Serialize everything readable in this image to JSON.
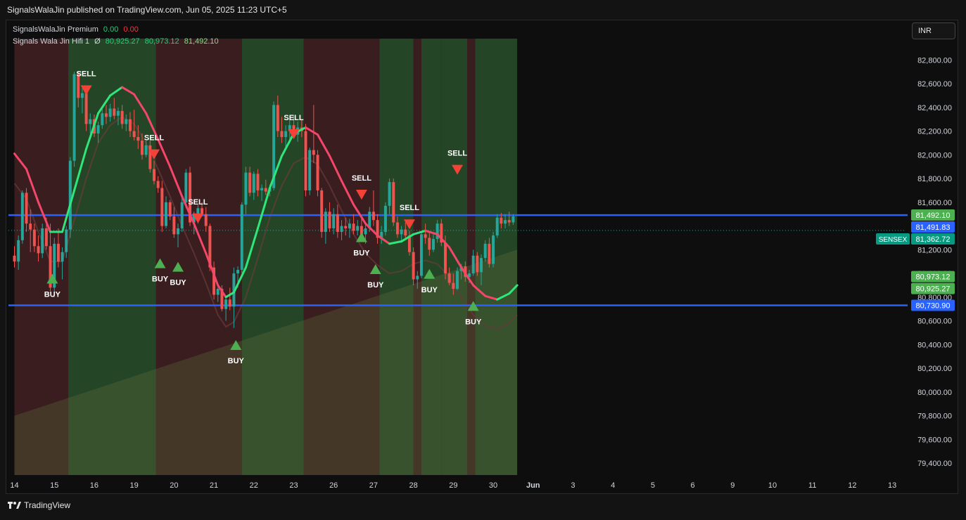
{
  "header": {
    "published": "SignalsWalaJin published on TradingView.com, Jun 05, 2025 11:23 UTC+5"
  },
  "legend": {
    "premium": {
      "name": "SignalsWalaJin Premium",
      "v1": "0.00",
      "v2": "0.00"
    },
    "hifi": {
      "name": "Signals Wala Jin Hifi 1",
      "symbol": "Ø",
      "v1": "80,925.27",
      "v2": "80,973.12",
      "v3": "81,492.10"
    }
  },
  "currency": "INR",
  "footer": {
    "brand": "TradingView"
  },
  "colors": {
    "up": "#26a69a",
    "down": "#ef5350",
    "curve_up": "#2ee67a",
    "curve_down": "#f4466a",
    "hline": "#2962ff",
    "zone_green": "#2d5a2f",
    "zone_red": "#4a2326"
  },
  "chart_data": {
    "type": "candlestick",
    "symbol": "SENSEX",
    "y_ticks": [
      79400,
      79600,
      79800,
      80000,
      80200,
      80400,
      80600,
      80800,
      81000,
      81200,
      81400,
      81600,
      81800,
      82000,
      82200,
      82400,
      82600,
      82800
    ],
    "y_tick_labels": [
      "79,400.00",
      "79,600.00",
      "79,800.00",
      "80,000.00",
      "80,200.00",
      "80,400.00",
      "80,600.00",
      "80,800.00",
      "81,000.00",
      "81,200.00",
      "81,400.00",
      "81,600.00",
      "81,800.00",
      "82,000.00",
      "82,200.00",
      "82,400.00",
      "82,600.00",
      "82,800.00"
    ],
    "ylim": [
      79300,
      82950
    ],
    "x_ticks": [
      {
        "label": "14",
        "t": 0
      },
      {
        "label": "15",
        "t": 1
      },
      {
        "label": "16",
        "t": 2
      },
      {
        "label": "19",
        "t": 3
      },
      {
        "label": "20",
        "t": 4
      },
      {
        "label": "21",
        "t": 5
      },
      {
        "label": "22",
        "t": 6
      },
      {
        "label": "23",
        "t": 7
      },
      {
        "label": "26",
        "t": 8
      },
      {
        "label": "27",
        "t": 9
      },
      {
        "label": "28",
        "t": 10
      },
      {
        "label": "29",
        "t": 11
      },
      {
        "label": "30",
        "t": 12
      },
      {
        "label": "Jun",
        "t": 13
      },
      {
        "label": "3",
        "t": 14
      },
      {
        "label": "4",
        "t": 15
      },
      {
        "label": "5",
        "t": 16
      },
      {
        "label": "6",
        "t": 17
      },
      {
        "label": "9",
        "t": 18
      },
      {
        "label": "10",
        "t": 19
      },
      {
        "label": "11",
        "t": 20
      },
      {
        "label": "12",
        "t": 21
      },
      {
        "label": "13",
        "t": 22
      }
    ],
    "xlim": [
      -0.15,
      22.35
    ],
    "candles": [
      [
        0.0,
        81150,
        81230,
        81050,
        81100
      ],
      [
        0.1,
        81100,
        81320,
        81030,
        81280
      ],
      [
        0.2,
        81280,
        81700,
        81250,
        81680
      ],
      [
        0.3,
        81680,
        81720,
        81350,
        81420
      ],
      [
        0.4,
        81420,
        81540,
        81180,
        81370
      ],
      [
        0.5,
        81370,
        81420,
        81180,
        81230
      ],
      [
        0.6,
        81230,
        81320,
        81100,
        81170
      ],
      [
        0.7,
        81170,
        81420,
        81130,
        81380
      ],
      [
        0.8,
        81380,
        81470,
        81200,
        81230
      ],
      [
        0.9,
        81230,
        81420,
        80850,
        80880
      ],
      [
        1.0,
        80880,
        81300,
        80800,
        81250
      ],
      [
        1.1,
        81250,
        81380,
        81050,
        81100
      ],
      [
        1.2,
        81100,
        81220,
        80950,
        81180
      ],
      [
        1.3,
        81180,
        81400,
        81130,
        81370
      ],
      [
        1.4,
        81370,
        81980,
        81300,
        81950
      ],
      [
        1.5,
        81950,
        82700,
        81900,
        82680
      ],
      [
        1.6,
        82680,
        82700,
        82400,
        82480
      ],
      [
        1.7,
        82480,
        82560,
        82350,
        82520
      ],
      [
        1.8,
        82520,
        82560,
        82200,
        82260
      ],
      [
        1.9,
        82260,
        82350,
        82180,
        82300
      ],
      [
        2.0,
        82300,
        82340,
        82150,
        82180
      ],
      [
        2.1,
        82180,
        82280,
        82100,
        82250
      ],
      [
        2.2,
        82250,
        82400,
        82220,
        82350
      ],
      [
        2.3,
        82350,
        82420,
        82260,
        82320
      ],
      [
        2.4,
        82320,
        82430,
        82280,
        82390
      ],
      [
        2.5,
        82390,
        82480,
        82300,
        82330
      ],
      [
        2.6,
        82330,
        82400,
        82250,
        82370
      ],
      [
        2.7,
        82370,
        82420,
        82220,
        82260
      ],
      [
        2.8,
        82260,
        82340,
        82200,
        82300
      ],
      [
        2.9,
        82300,
        82360,
        82150,
        82200
      ],
      [
        3.0,
        82200,
        82380,
        82120,
        82150
      ],
      [
        3.1,
        82150,
        82250,
        82050,
        82120
      ],
      [
        3.2,
        82120,
        82180,
        81960,
        82000
      ],
      [
        3.3,
        82000,
        82120,
        81980,
        82080
      ],
      [
        3.4,
        82080,
        82120,
        81850,
        81880
      ],
      [
        3.5,
        81880,
        81950,
        81750,
        81780
      ],
      [
        3.6,
        81780,
        81820,
        81680,
        81720
      ],
      [
        3.7,
        81720,
        81780,
        81350,
        81400
      ],
      [
        3.8,
        81400,
        81650,
        81380,
        81600
      ],
      [
        3.9,
        81600,
        81620,
        81450,
        81480
      ],
      [
        4.0,
        81480,
        81560,
        81300,
        81330
      ],
      [
        4.1,
        81330,
        81420,
        81220,
        81380
      ],
      [
        4.2,
        81380,
        81650,
        81350,
        81600
      ],
      [
        4.3,
        81600,
        81880,
        81550,
        81850
      ],
      [
        4.4,
        81850,
        81900,
        81400,
        81430
      ],
      [
        4.5,
        81430,
        81520,
        81330,
        81500
      ],
      [
        4.6,
        81500,
        81580,
        81420,
        81550
      ],
      [
        4.7,
        81550,
        81600,
        81480,
        81500
      ],
      [
        4.8,
        81500,
        81560,
        81350,
        81400
      ],
      [
        4.9,
        81400,
        81420,
        81020,
        81050
      ],
      [
        5.0,
        81050,
        81100,
        80780,
        80820
      ],
      [
        5.1,
        80820,
        80900,
        80760,
        80870
      ],
      [
        5.2,
        80870,
        80900,
        80680,
        80700
      ],
      [
        5.3,
        80700,
        80800,
        80600,
        80780
      ],
      [
        5.4,
        80780,
        80880,
        80690,
        80720
      ],
      [
        5.5,
        80720,
        81050,
        80540,
        81000
      ],
      [
        5.6,
        81000,
        81060,
        80880,
        81030
      ],
      [
        5.7,
        81030,
        81600,
        81000,
        81580
      ],
      [
        5.8,
        81580,
        81900,
        81500,
        81850
      ],
      [
        5.9,
        81850,
        81900,
        81650,
        81680
      ],
      [
        6.0,
        81680,
        81860,
        81620,
        81840
      ],
      [
        6.1,
        81840,
        81880,
        81650,
        81700
      ],
      [
        6.2,
        81700,
        81750,
        81610,
        81720
      ],
      [
        6.3,
        81720,
        81790,
        81660,
        81690
      ],
      [
        6.4,
        81690,
        81750,
        81650,
        81720
      ],
      [
        6.5,
        81720,
        82450,
        81700,
        82420
      ],
      [
        6.6,
        82420,
        82500,
        82150,
        82200
      ],
      [
        6.7,
        82200,
        82320,
        82100,
        82150
      ],
      [
        6.8,
        82150,
        82250,
        82060,
        82200
      ],
      [
        6.9,
        82200,
        82300,
        82120,
        82250
      ],
      [
        7.0,
        82250,
        82330,
        82140,
        82170
      ],
      [
        7.1,
        82170,
        82280,
        82110,
        82230
      ],
      [
        7.2,
        82230,
        82300,
        82150,
        82200
      ],
      [
        7.3,
        82200,
        82260,
        81650,
        81700
      ],
      [
        7.4,
        81700,
        82060,
        81660,
        82040
      ],
      [
        7.5,
        82040,
        82420,
        81930,
        82000
      ],
      [
        7.6,
        82000,
        82040,
        81650,
        81700
      ],
      [
        7.7,
        81700,
        81720,
        81300,
        81350
      ],
      [
        7.8,
        81350,
        81550,
        81250,
        81520
      ],
      [
        7.9,
        81520,
        81600,
        81350,
        81380
      ],
      [
        8.0,
        81380,
        81550,
        81330,
        81500
      ],
      [
        8.1,
        81500,
        81580,
        81300,
        81350
      ],
      [
        8.2,
        81350,
        81450,
        81280,
        81400
      ],
      [
        8.3,
        81400,
        81470,
        81320,
        81380
      ],
      [
        8.4,
        81380,
        81460,
        81300,
        81420
      ],
      [
        8.5,
        81420,
        81500,
        81330,
        81360
      ],
      [
        8.6,
        81360,
        81450,
        81320,
        81400
      ],
      [
        8.7,
        81400,
        81480,
        81300,
        81330
      ],
      [
        8.8,
        81330,
        81420,
        81250,
        81380
      ],
      [
        8.9,
        81380,
        81560,
        81350,
        81520
      ],
      [
        9.0,
        81520,
        81700,
        81400,
        81450
      ],
      [
        9.1,
        81450,
        81500,
        81250,
        81300
      ],
      [
        9.2,
        81300,
        81400,
        81250,
        81350
      ],
      [
        9.3,
        81350,
        81600,
        81320,
        81570
      ],
      [
        9.4,
        81570,
        81800,
        81500,
        81770
      ],
      [
        9.5,
        81770,
        81800,
        81400,
        81430
      ],
      [
        9.6,
        81430,
        81480,
        81300,
        81330
      ],
      [
        9.7,
        81330,
        81400,
        81280,
        81370
      ],
      [
        9.8,
        81370,
        81430,
        81300,
        81320
      ],
      [
        9.9,
        81320,
        81360,
        81150,
        81180
      ],
      [
        10.0,
        81180,
        81220,
        80900,
        80950
      ],
      [
        10.1,
        80950,
        81020,
        80870,
        80980
      ],
      [
        10.2,
        80980,
        81350,
        80960,
        81330
      ],
      [
        10.3,
        81330,
        81420,
        81250,
        81300
      ],
      [
        10.4,
        81300,
        81350,
        81150,
        81200
      ],
      [
        10.5,
        81200,
        81330,
        81180,
        81290
      ],
      [
        10.6,
        81290,
        81450,
        81260,
        81420
      ],
      [
        10.7,
        81420,
        81460,
        81230,
        81260
      ],
      [
        10.8,
        81260,
        81320,
        80950,
        81000
      ],
      [
        10.9,
        81000,
        81050,
        80900,
        80920
      ],
      [
        11.0,
        80920,
        81000,
        80820,
        80870
      ],
      [
        11.1,
        80870,
        81050,
        80860,
        81020
      ],
      [
        11.2,
        81020,
        81080,
        80950,
        81060
      ],
      [
        11.3,
        81060,
        81100,
        80930,
        80970
      ],
      [
        11.4,
        80970,
        81030,
        80920,
        81000
      ],
      [
        11.5,
        81000,
        81200,
        80980,
        81150
      ],
      [
        11.6,
        81150,
        81180,
        80980,
        81010
      ],
      [
        11.7,
        81010,
        81160,
        80900,
        81130
      ],
      [
        11.8,
        81130,
        81280,
        81100,
        81250
      ],
      [
        11.9,
        81250,
        81300,
        81050,
        81080
      ],
      [
        12.0,
        81080,
        81350,
        81050,
        81320
      ],
      [
        12.1,
        81320,
        81500,
        81300,
        81470
      ],
      [
        12.2,
        81470,
        81510,
        81380,
        81420
      ],
      [
        12.3,
        81420,
        81500,
        81380,
        81450
      ],
      [
        12.4,
        81450,
        81520,
        81400,
        81430
      ],
      [
        12.5,
        81430,
        81500,
        81410,
        81480
      ]
    ],
    "curve": [
      [
        0,
        82010
      ],
      [
        0.3,
        81880
      ],
      [
        0.6,
        81600
      ],
      [
        0.9,
        81350
      ],
      [
        1.2,
        81350
      ],
      [
        1.5,
        81700
      ],
      [
        1.8,
        82050
      ],
      [
        2.1,
        82350
      ],
      [
        2.4,
        82500
      ],
      [
        2.7,
        82570
      ],
      [
        3.0,
        82510
      ],
      [
        3.3,
        82350
      ],
      [
        3.6,
        82130
      ],
      [
        3.9,
        81900
      ],
      [
        4.2,
        81650
      ],
      [
        4.5,
        81420
      ],
      [
        4.8,
        81170
      ],
      [
        5.1,
        80900
      ],
      [
        5.3,
        80800
      ],
      [
        5.5,
        80840
      ],
      [
        5.8,
        81050
      ],
      [
        6.1,
        81380
      ],
      [
        6.4,
        81720
      ],
      [
        6.7,
        81990
      ],
      [
        7.0,
        82180
      ],
      [
        7.3,
        82230
      ],
      [
        7.6,
        82170
      ],
      [
        7.9,
        81990
      ],
      [
        8.2,
        81780
      ],
      [
        8.5,
        81580
      ],
      [
        8.8,
        81420
      ],
      [
        9.1,
        81320
      ],
      [
        9.4,
        81250
      ],
      [
        9.7,
        81270
      ],
      [
        10.0,
        81330
      ],
      [
        10.3,
        81360
      ],
      [
        10.6,
        81330
      ],
      [
        10.9,
        81220
      ],
      [
        11.2,
        81050
      ],
      [
        11.5,
        80900
      ],
      [
        11.8,
        80810
      ],
      [
        12.1,
        80780
      ],
      [
        12.4,
        80830
      ],
      [
        12.6,
        80900
      ]
    ],
    "hlines": [
      81491.83,
      80730.9
    ],
    "signals": [
      {
        "type": "BUY",
        "x": 0.95,
        "y": 80950
      },
      {
        "type": "SELL",
        "x": 1.8,
        "y": 82550
      },
      {
        "type": "SELL",
        "x": 3.5,
        "y": 82010
      },
      {
        "type": "BUY",
        "x": 3.65,
        "y": 81080
      },
      {
        "type": "BUY",
        "x": 4.1,
        "y": 81050
      },
      {
        "type": "SELL",
        "x": 4.6,
        "y": 81470
      },
      {
        "type": "BUY",
        "x": 5.55,
        "y": 80390
      },
      {
        "type": "SELL",
        "x": 7.0,
        "y": 82180
      },
      {
        "type": "SELL",
        "x": 8.7,
        "y": 81670
      },
      {
        "type": "BUY",
        "x": 8.7,
        "y": 81300
      },
      {
        "type": "BUY",
        "x": 9.05,
        "y": 81030
      },
      {
        "type": "SELL",
        "x": 9.9,
        "y": 81420
      },
      {
        "type": "BUY",
        "x": 10.4,
        "y": 80990
      },
      {
        "type": "SELL",
        "x": 11.1,
        "y": 81880
      },
      {
        "type": "BUY",
        "x": 11.5,
        "y": 80720
      }
    ],
    "zones": [
      {
        "from": 0.0,
        "to": 1.35,
        "color": "red"
      },
      {
        "from": 1.35,
        "to": 3.55,
        "color": "green"
      },
      {
        "from": 3.55,
        "to": 5.7,
        "color": "red"
      },
      {
        "from": 5.7,
        "to": 7.25,
        "color": "green"
      },
      {
        "from": 7.25,
        "to": 9.15,
        "color": "red"
      },
      {
        "from": 9.15,
        "to": 10.0,
        "color": "green"
      },
      {
        "from": 10.0,
        "to": 10.2,
        "color": "red"
      },
      {
        "from": 10.2,
        "to": 10.7,
        "color": "green"
      },
      {
        "from": 10.7,
        "to": 11.35,
        "color": "green"
      },
      {
        "from": 11.35,
        "to": 11.55,
        "color": "red"
      },
      {
        "from": 11.55,
        "to": 12.6,
        "color": "green"
      }
    ],
    "price_labels": [
      {
        "text": "81,492.10",
        "value": 81492.1,
        "kind": "green"
      },
      {
        "text": "81,491.83",
        "value": 81491.83,
        "kind": "blue"
      },
      {
        "text": "81,362.72",
        "value": 81362.72,
        "kind": "teal",
        "tag": "SENSEX"
      },
      {
        "text": "80,973.12",
        "value": 80973.12,
        "kind": "green"
      },
      {
        "text": "80,925.27",
        "value": 80925.27,
        "kind": "green"
      },
      {
        "text": "80,730.90",
        "value": 80730.9,
        "kind": "blue"
      }
    ]
  }
}
